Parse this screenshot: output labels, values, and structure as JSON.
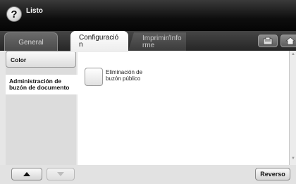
{
  "status": {
    "help_symbol": "?",
    "text": "Listo"
  },
  "tabs": {
    "general": "General",
    "configuracion": "Configuració\nn",
    "imprimir": "Imprimir/Info\nrme"
  },
  "sidebar": {
    "items": [
      {
        "label": "Color"
      },
      {
        "label": "Administración de\nbuzón de documento"
      }
    ]
  },
  "main": {
    "options": [
      {
        "label": "Eliminación de\nbuzón público"
      }
    ]
  },
  "footer": {
    "back_label": "Reverso"
  },
  "icons": {
    "help": "help-icon",
    "directory": "directory-icon",
    "home": "home-icon",
    "up": "arrow-up-icon",
    "down": "arrow-down-icon"
  }
}
